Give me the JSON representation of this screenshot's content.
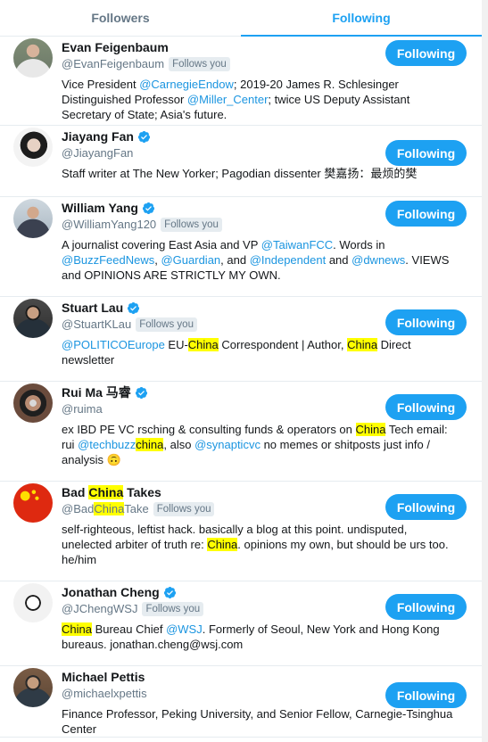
{
  "tabs": {
    "followers": "Followers",
    "following": "Following"
  },
  "follow_label": "Following",
  "follows_you": "Follows you",
  "accounts": [
    {
      "name": "Evan Feigenbaum",
      "handle": "@EvanFeigenbaum",
      "verified": false,
      "follows_you": true,
      "bio": [
        [
          "Vice President "
        ],
        [
          "@CarnegieEndow",
          "link"
        ],
        [
          "; 2019-20 James R. Schlesinger Distinguished Professor "
        ],
        [
          "@Miller_Center",
          "link"
        ],
        [
          "; twice US Deputy Assistant Secretary of State; Asia's future."
        ]
      ]
    },
    {
      "name": "Jiayang Fan",
      "handle": "@JiayangFan",
      "verified": true,
      "follows_you": false,
      "bio": [
        [
          "Staff writer at The New Yorker; Pagodian dissenter 樊嘉扬：最烦的樊"
        ]
      ]
    },
    {
      "name": "William Yang",
      "handle": "@WilliamYang120",
      "verified": true,
      "follows_you": true,
      "bio": [
        [
          "A journalist covering East Asia and VP "
        ],
        [
          "@TaiwanFCC",
          "link"
        ],
        [
          ". Words in "
        ],
        [
          "@BuzzFeedNews",
          "link"
        ],
        [
          ", "
        ],
        [
          "@Guardian",
          "link"
        ],
        [
          ", and "
        ],
        [
          "@Independent",
          "link"
        ],
        [
          " and "
        ],
        [
          "@dwnews",
          "link"
        ],
        [
          ". VIEWS and OPINIONS ARE STRICTLY MY OWN."
        ]
      ]
    },
    {
      "name": "Stuart Lau",
      "handle": "@StuartKLau",
      "verified": true,
      "follows_you": true,
      "bio": [
        [
          "@POLITICOEurope",
          "link"
        ],
        [
          " EU-"
        ],
        [
          "China",
          "hl"
        ],
        [
          " Correspondent | Author, "
        ],
        [
          "China",
          "hl"
        ],
        [
          " Direct newsletter"
        ]
      ]
    },
    {
      "name": "Rui Ma 马睿",
      "handle": "@ruima",
      "verified": true,
      "follows_you": false,
      "bio": [
        [
          "ex IBD PE VC rsching & consulting funds & operators on "
        ],
        [
          "China",
          "hl"
        ],
        [
          " Tech email: rui "
        ],
        [
          "@techbuzz",
          "link"
        ],
        [
          "china",
          "hl"
        ],
        [
          ", also "
        ],
        [
          "@synapticvc",
          "link"
        ],
        [
          " no memes or shitposts just info / analysis 🙃"
        ]
      ]
    },
    {
      "name": "Bad China Takes",
      "handle": "@BadChinaTake",
      "verified": false,
      "follows_you": true,
      "bio": [
        [
          "self-righteous, leftist hack. basically a blog at this point. undisputed, unelected arbiter of truth re: "
        ],
        [
          "China",
          "hl"
        ],
        [
          ". opinions my own, but should be urs too. he/him"
        ]
      ]
    },
    {
      "name": "Jonathan Cheng",
      "handle": "@JChengWSJ",
      "verified": true,
      "follows_you": true,
      "bio": [
        [
          "China",
          "hl"
        ],
        [
          " Bureau Chief "
        ],
        [
          "@WSJ",
          "link"
        ],
        [
          ". Formerly of Seoul, New York and Hong Kong bureaus. jonathan.cheng@wsj.com"
        ]
      ]
    },
    {
      "name": "Michael Pettis",
      "handle": "@michaelxpettis",
      "verified": false,
      "follows_you": false,
      "bio": [
        [
          "Finance Professor, Peking University, and Senior Fellow, Carnegie-Tsinghua Center"
        ]
      ]
    }
  ]
}
